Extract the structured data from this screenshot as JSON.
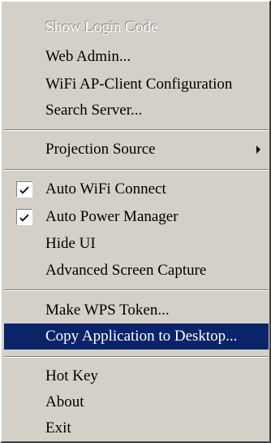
{
  "menu": {
    "items": {
      "show_login_code": {
        "label": "Show Login Code",
        "enabled": false
      },
      "web_admin": {
        "label": "Web Admin..."
      },
      "wifi_ap_client": {
        "label": "WiFi AP-Client Configuration"
      },
      "search_server": {
        "label": "Search Server..."
      },
      "projection_source": {
        "label": "Projection Source",
        "submenu_icon": "submenu-arrow-icon"
      },
      "auto_wifi_connect": {
        "label": "Auto WiFi Connect",
        "checked": true
      },
      "auto_power_manager": {
        "label": "Auto Power Manager",
        "checked": true
      },
      "hide_ui": {
        "label": "Hide UI"
      },
      "advanced_screen_capture": {
        "label": "Advanced Screen Capture"
      },
      "make_wps_token": {
        "label": "Make WPS Token..."
      },
      "copy_application": {
        "label": "Copy Application to Desktop...",
        "highlighted": true
      },
      "hot_key": {
        "label": "Hot Key"
      },
      "about": {
        "label": "About"
      },
      "exit": {
        "label": "Exit"
      }
    },
    "colors": {
      "menu_background": "#d4d0c8",
      "highlight_background": "#0a246a",
      "highlight_text": "#ffffff",
      "disabled_text": "#8c8a85"
    },
    "icons": {
      "checkmark": "checkmark-icon",
      "submenu": "submenu-arrow-icon"
    }
  }
}
